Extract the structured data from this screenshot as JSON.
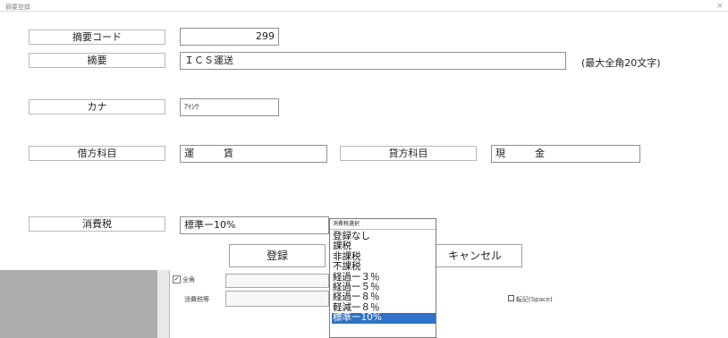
{
  "window": {
    "title": "摘要登録",
    "close_glyph": "×"
  },
  "form": {
    "code_label": "摘要コード",
    "code_value": "299",
    "summary_label": "摘要",
    "summary_value": "ＩＣＳ運送",
    "summary_note": "(最大全角20文字)",
    "kana_label": "カナ",
    "kana_value": "ｱｲｼｳ",
    "debit_label": "借方科目",
    "debit_value": "運　　　賃",
    "credit_label": "貸方科目",
    "credit_value": "現　　　金",
    "tax_label": "消費税",
    "tax_value": "標準ー10%",
    "register_button": "登録",
    "cancel_button": "キャンセル"
  },
  "tax_dropdown": {
    "title": "消費税選択",
    "options": [
      "登録なし",
      "課税",
      "非課税",
      "不課税",
      "経過ー３％",
      "経過ー５％",
      "経過ー８％",
      "軽減ー８％",
      "標準ー10%"
    ],
    "selected_index": 8
  },
  "background": {
    "checkbox_label": "全角",
    "tax_label": "消費税等",
    "furigana_checkbox_label": "転記(Space)"
  }
}
